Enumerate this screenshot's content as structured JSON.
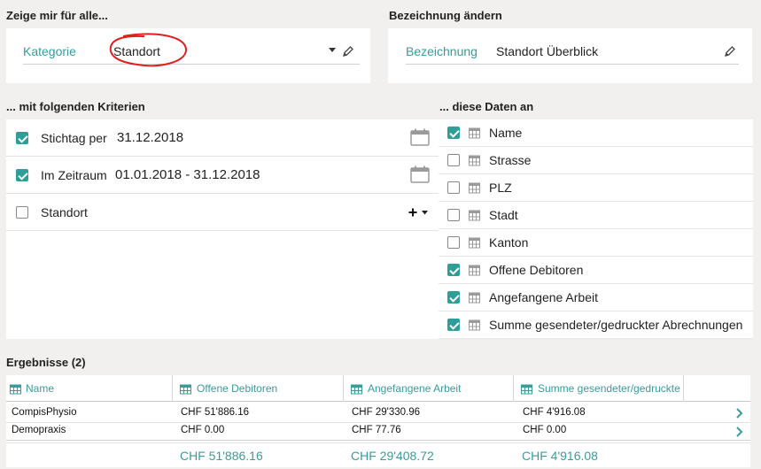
{
  "colors": {
    "accent": "#3a9c9a",
    "check": "#2f9e99",
    "annotation": "#e02020"
  },
  "show_for": {
    "title": "Zeige mir für alle...",
    "category_label": "Kategorie",
    "category_value": "Standort"
  },
  "rename": {
    "title": "Bezeichnung ändern",
    "label": "Bezeichnung",
    "value": "Standort Überblick"
  },
  "criteria": {
    "title": "... mit folgenden Kriterien",
    "rows": [
      {
        "checked": true,
        "label": "Stichtag per",
        "value": "31.12.2018",
        "icon": "calendar-icon"
      },
      {
        "checked": true,
        "label": "Im Zeitraum",
        "value": "01.01.2018 - 31.12.2018",
        "icon": "calendar-icon"
      },
      {
        "checked": false,
        "label": "Standort",
        "value": "",
        "icon": "plus-dropdown-icon"
      }
    ]
  },
  "data_fields": {
    "title": "... diese Daten an",
    "items": [
      {
        "checked": true,
        "label": "Name"
      },
      {
        "checked": false,
        "label": "Strasse"
      },
      {
        "checked": false,
        "label": "PLZ"
      },
      {
        "checked": false,
        "label": "Stadt"
      },
      {
        "checked": false,
        "label": "Kanton"
      },
      {
        "checked": true,
        "label": "Offene Debitoren"
      },
      {
        "checked": true,
        "label": "Angefangene Arbeit"
      },
      {
        "checked": true,
        "label": "Summe gesendeter/gedruckter Abrechnungen"
      }
    ]
  },
  "results": {
    "title": "Ergebnisse (2)",
    "columns": [
      "Name",
      "Offene Debitoren",
      "Angefangene Arbeit",
      "Summe gesendeter/gedruckte"
    ],
    "rows": [
      [
        "CompisPhysio",
        "CHF 51'886.16",
        "CHF 29'330.96",
        "CHF 4'916.08"
      ],
      [
        "Demopraxis",
        "CHF 0.00",
        "CHF 77.76",
        "CHF 0.00"
      ]
    ],
    "totals": [
      "",
      "CHF 51'886.16",
      "CHF 29'408.72",
      "CHF 4'916.08"
    ]
  }
}
